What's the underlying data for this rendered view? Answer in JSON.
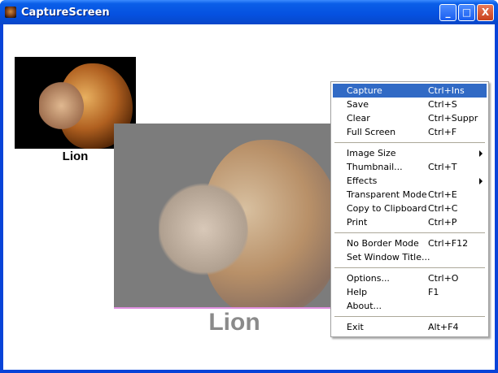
{
  "window": {
    "title": "CaptureScreen",
    "controls": {
      "minimize": "_",
      "maximize": "□",
      "close": "X"
    }
  },
  "thumbnail": {
    "label": "Lion"
  },
  "preview": {
    "label": "Lion"
  },
  "menu": {
    "groups": [
      [
        {
          "label": "Capture",
          "shortcut": "Ctrl+Ins",
          "highlighted": true
        },
        {
          "label": "Save",
          "shortcut": "Ctrl+S"
        },
        {
          "label": "Clear",
          "shortcut": "Ctrl+Suppr"
        },
        {
          "label": "Full Screen",
          "shortcut": "Ctrl+F"
        }
      ],
      [
        {
          "label": "Image Size",
          "shortcut": "",
          "submenu": true
        },
        {
          "label": "Thumbnail...",
          "shortcut": "Ctrl+T"
        },
        {
          "label": "Effects",
          "shortcut": "",
          "submenu": true
        },
        {
          "label": "Transparent Mode",
          "shortcut": "Ctrl+E"
        },
        {
          "label": "Copy to Clipboard",
          "shortcut": "Ctrl+C"
        },
        {
          "label": "Print",
          "shortcut": "Ctrl+P"
        }
      ],
      [
        {
          "label": "No Border Mode",
          "shortcut": "Ctrl+F12"
        },
        {
          "label": "Set Window Title...",
          "shortcut": ""
        }
      ],
      [
        {
          "label": "Options...",
          "shortcut": "Ctrl+O"
        },
        {
          "label": "Help",
          "shortcut": "F1"
        },
        {
          "label": "About...",
          "shortcut": ""
        }
      ],
      [
        {
          "label": "Exit",
          "shortcut": "Alt+F4"
        }
      ]
    ]
  }
}
